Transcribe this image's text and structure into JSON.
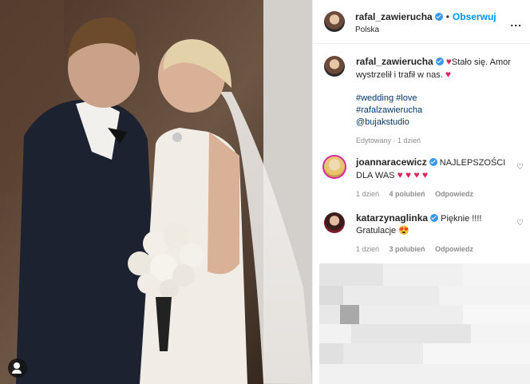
{
  "post": {
    "author": "rafal_zawierucha",
    "follow_label": "Obserwuj",
    "location": "Polska",
    "more_label": "...",
    "caption_text": "Stało się. Amor wystrzelił i trafił w nas.",
    "hashtags": [
      "#wedding #love",
      "#rafalzawierucha",
      "@bujakstudio"
    ],
    "caption_meta": "Edytowany · 1 dzień"
  },
  "comments": [
    {
      "user": "joannaracewicz",
      "text": "NAJLEPSZOŚCI DLA WAS",
      "hearts": "♥ ♥ ♥ ♥",
      "time": "1 dzień",
      "likes": "4 polubień",
      "reply": "Odpowiedz"
    },
    {
      "user": "katarzynaglinka",
      "text": "Pięknie !!!! Gratulacje",
      "emoji": "😍",
      "time": "1 dzień",
      "likes": "3 polubień",
      "reply": "Odpowiedz"
    }
  ],
  "colors": {
    "link": "#00376b",
    "follow": "#0095f6",
    "heart": "#e0245e",
    "muted": "#8e8e8e"
  }
}
